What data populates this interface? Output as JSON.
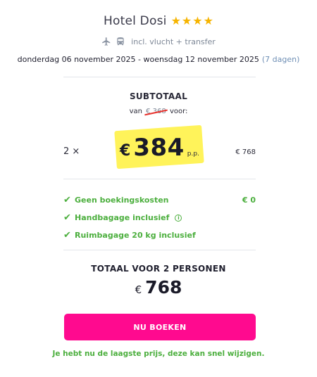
{
  "header": {
    "hotel_name": "Hotel Dosi",
    "star_count": 4,
    "star_color": "#f6b400"
  },
  "includes": {
    "icons": [
      "plane-icon",
      "bus-icon"
    ],
    "text": "incl. vlucht + transfer"
  },
  "dates": {
    "range": "donderdag 06 november 2025 - woensdag 12 november 2025",
    "duration": "(7 dagen)"
  },
  "subtotal": {
    "label": "SUBTOTAAL",
    "from_prefix": "van",
    "old_price": "€ 368",
    "from_suffix": "voor:",
    "quantity": "2 ×",
    "currency": "€",
    "price_per_person": "384",
    "per_person_label": "p.p.",
    "row_total": "€ 768"
  },
  "features": [
    {
      "label": "Geen boekingskosten",
      "amount": "€ 0",
      "info": false
    },
    {
      "label": "Handbagage inclusief",
      "amount": "",
      "info": true
    },
    {
      "label": "Ruimbagage 20 kg inclusief",
      "amount": "",
      "info": false
    }
  ],
  "total": {
    "label": "TOTAAL VOOR 2 PERSONEN",
    "currency": "€",
    "value": "768"
  },
  "cta": {
    "label": "NU BOEKEN",
    "color": "#ff0a8f"
  },
  "note": "Je hebt nu de laagste prijs, deze kan snel wijzigen.",
  "colors": {
    "accent_green": "#4caf3e",
    "highlight_yellow": "#fff35a",
    "strike_red": "#e8322d"
  }
}
